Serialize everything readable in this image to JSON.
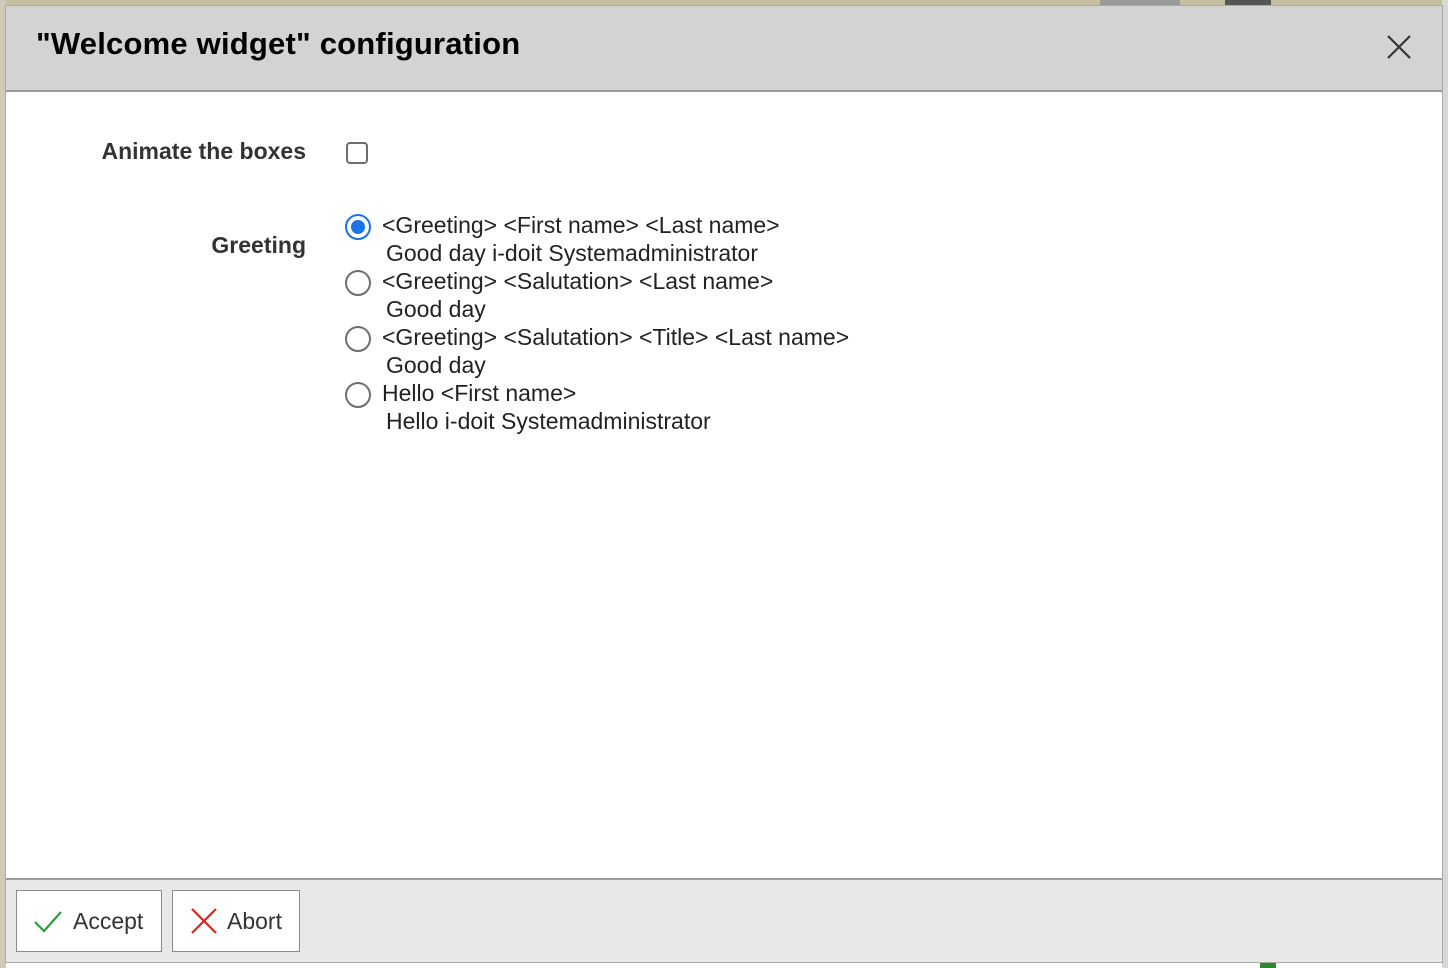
{
  "dialog": {
    "title": "\"Welcome widget\" configuration",
    "close_icon": "close-icon"
  },
  "form": {
    "animate_label": "Animate the boxes",
    "animate_checked": false,
    "greeting_label": "Greeting",
    "greeting_options": [
      {
        "label": "<Greeting> <First name> <Last name>",
        "preview": "Good day i-doit Systemadministrator",
        "checked": true
      },
      {
        "label": "<Greeting> <Salutation> <Last name>",
        "preview": "Good day",
        "checked": false
      },
      {
        "label": "<Greeting> <Salutation> <Title> <Last name>",
        "preview": "Good day",
        "checked": false
      },
      {
        "label": "Hello <First name>",
        "preview": "Hello i-doit Systemadministrator",
        "checked": false
      }
    ]
  },
  "footer": {
    "accept_label": "Accept",
    "accept_icon": "checkmark-icon",
    "abort_label": "Abort",
    "abort_icon": "cross-icon"
  },
  "colors": {
    "radio_accent": "#1a73e8",
    "accept_icon": "#2e9a3e",
    "abort_icon": "#d9261c",
    "header_bg": "#d3d3d3",
    "footer_bg": "#e8e8e8"
  }
}
